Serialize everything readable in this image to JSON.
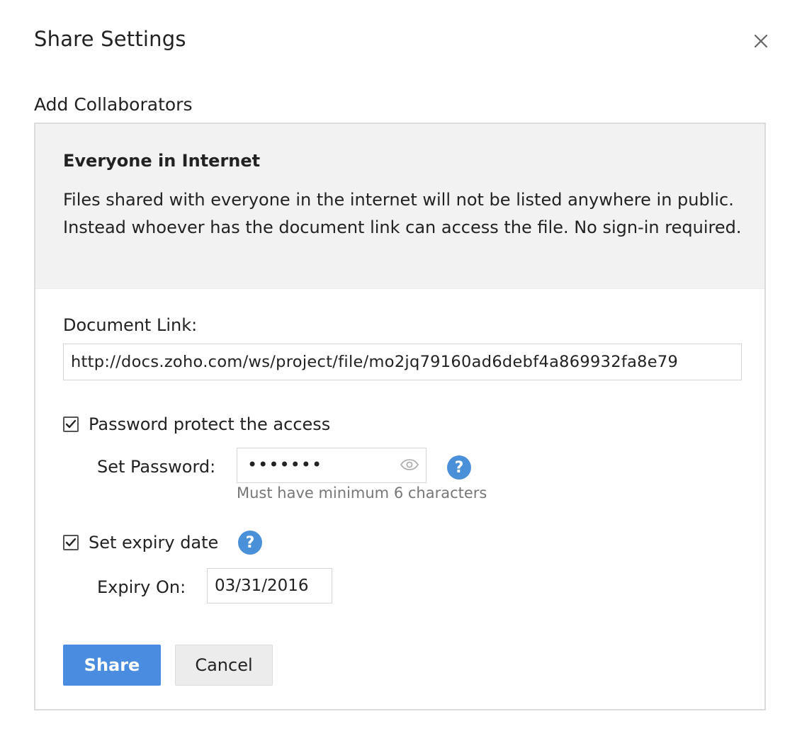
{
  "dialog": {
    "title": "Share Settings",
    "close_icon": "close-icon"
  },
  "section": {
    "label": "Add Collaborators"
  },
  "info": {
    "heading": "Everyone in Internet",
    "text": "Files shared with everyone in the internet will not be listed anywhere in public. Instead whoever has the document link can access the file. No sign-in required."
  },
  "link": {
    "label": "Document Link:",
    "value": "http://docs.zoho.com/ws/project/file/mo2jq79160ad6debf4a869932fa8e79"
  },
  "password": {
    "checkbox_label": "Password protect the access",
    "checked": true,
    "field_label": "Set Password:",
    "masked_value": "•••••••",
    "hint": "Must have minimum 6 characters",
    "help_icon": "?"
  },
  "expiry": {
    "checkbox_label": "Set expiry date",
    "checked": true,
    "help_icon": "?",
    "field_label": "Expiry On:",
    "value": "03/31/2016"
  },
  "buttons": {
    "share": "Share",
    "cancel": "Cancel"
  },
  "colors": {
    "accent": "#4a8de0",
    "help_icon": "#4a90d9",
    "panel_bg": "#f2f2f2",
    "border": "#dcdcdc"
  }
}
